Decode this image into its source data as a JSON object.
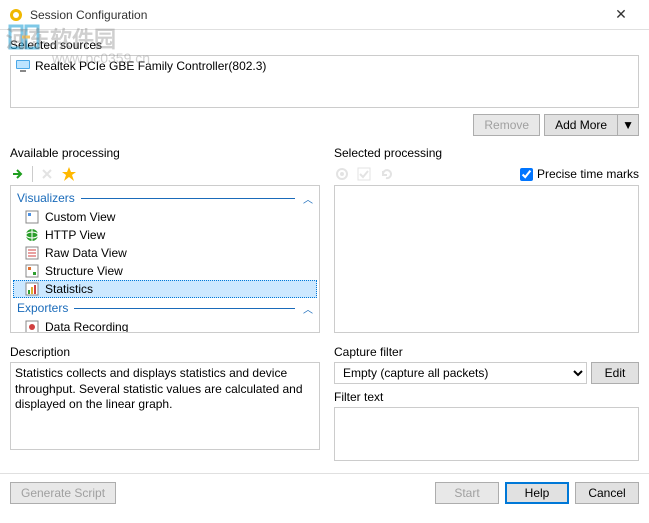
{
  "window": {
    "title": "Session Configuration",
    "close": "✕"
  },
  "watermark": {
    "text": "河东软件园",
    "url": "www.pc0359.cn"
  },
  "sources": {
    "label": "Selected sources",
    "items": [
      {
        "name": "Realtek PCIe GBE Family Controller(802.3)"
      }
    ],
    "remove_btn": "Remove",
    "add_more_btn": "Add More"
  },
  "available": {
    "label": "Available processing",
    "groups": [
      {
        "name": "Visualizers",
        "items": [
          {
            "label": "Custom View",
            "icon": "custom"
          },
          {
            "label": "HTTP View",
            "icon": "http"
          },
          {
            "label": "Raw Data View",
            "icon": "raw"
          },
          {
            "label": "Structure View",
            "icon": "struct"
          },
          {
            "label": "Statistics",
            "icon": "stats",
            "selected": true
          }
        ]
      },
      {
        "name": "Exporters",
        "items": [
          {
            "label": "Data Recording",
            "icon": "record"
          }
        ]
      }
    ]
  },
  "selected": {
    "label": "Selected processing",
    "precise_label": "Precise time marks",
    "precise_checked": true
  },
  "description": {
    "label": "Description",
    "text": "Statistics collects and displays statistics and device throughput. Several statistic values are calculated and displayed on the linear graph."
  },
  "capture_filter": {
    "label": "Capture filter",
    "value": "Empty (capture all packets)",
    "edit_btn": "Edit"
  },
  "filter_text": {
    "label": "Filter text"
  },
  "buttons": {
    "generate_script": "Generate Script",
    "start": "Start",
    "help": "Help",
    "cancel": "Cancel"
  }
}
